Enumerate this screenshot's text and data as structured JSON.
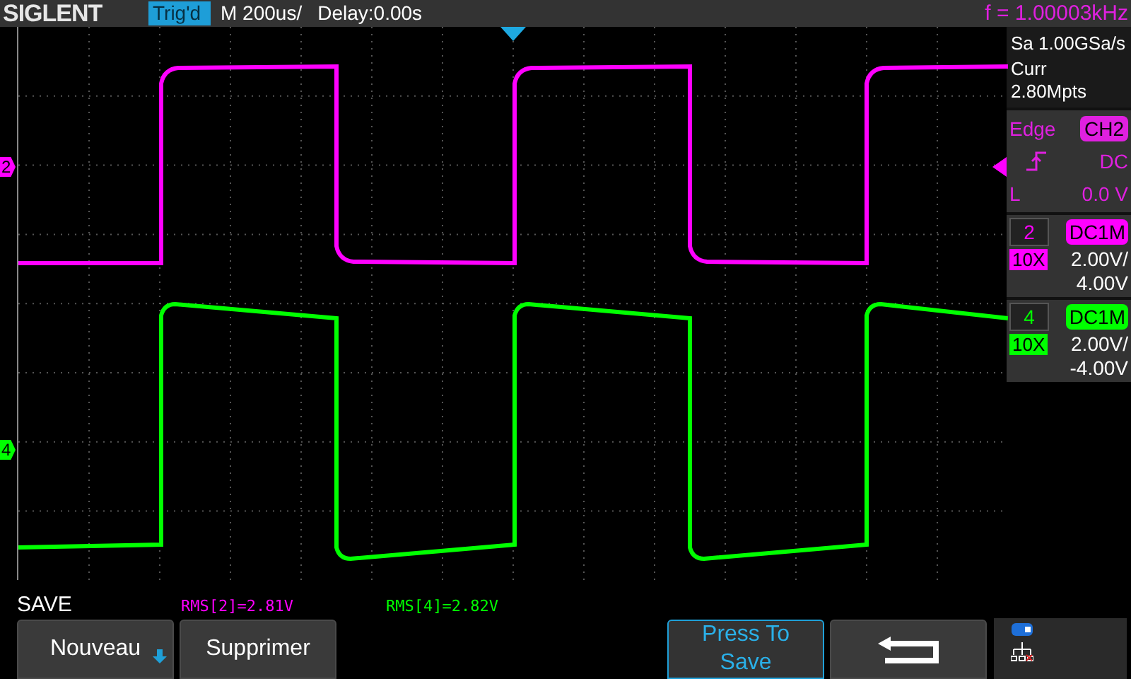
{
  "header": {
    "logo": "SIGLENT",
    "trigger_status": "Trig'd",
    "timebase": "M 200us/",
    "delay": "Delay:0.00s",
    "frequency": "f = 1.00003kHz"
  },
  "acquisition": {
    "sample_rate": "Sa 1.00GSa/s",
    "memory_depth": "Curr 2.80Mpts"
  },
  "trigger": {
    "type": "Edge",
    "source": "CH2",
    "coupling": "DC",
    "level_label": "L",
    "level": "0.0 V"
  },
  "channels": [
    {
      "marker": "2",
      "number": "2",
      "coupling": "DC1M",
      "probe": "10X",
      "scale": "2.00V/",
      "offset": "4.00V",
      "color": "#ff00ff"
    },
    {
      "marker": "4",
      "number": "4",
      "coupling": "DC1M",
      "probe": "10X",
      "scale": "2.00V/",
      "offset": "-4.00V",
      "color": "#00ff00"
    }
  ],
  "menu": {
    "title": "SAVE",
    "measurements": [
      {
        "text": "RMS[2]=2.81V",
        "color": "#ff00ff"
      },
      {
        "text": "RMS[4]=2.82V",
        "color": "#00ff00"
      }
    ],
    "softkeys": [
      {
        "kind": "dropdown",
        "label": "Nouveau",
        "highlighted": false
      },
      {
        "kind": "text",
        "label": "Supprimer",
        "highlighted": false
      },
      {
        "kind": "blank"
      },
      {
        "kind": "blank"
      },
      {
        "kind": "text",
        "label": "Press To Save",
        "highlighted": true
      },
      {
        "kind": "back"
      }
    ]
  }
}
